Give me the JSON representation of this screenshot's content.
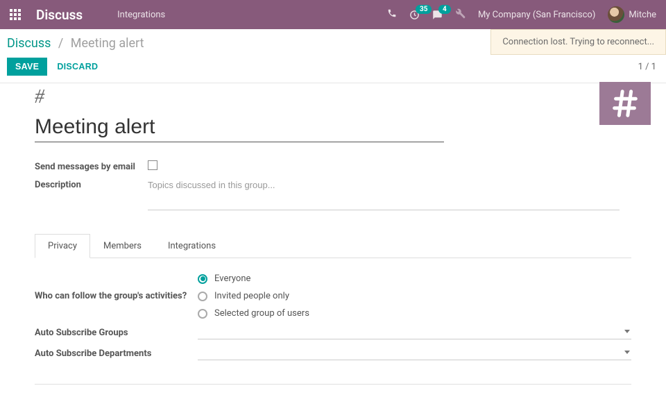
{
  "navbar": {
    "brand": "Discuss",
    "menu": {
      "integrations": "Integrations"
    },
    "badges": {
      "activities": "35",
      "messages": "4"
    },
    "company": "My Company (San Francisco)",
    "user": "Mitche"
  },
  "toast": {
    "message": "Connection lost. Trying to reconnect..."
  },
  "breadcrumb": {
    "root": "Discuss",
    "current": "Meeting alert"
  },
  "actions": {
    "save": "SAVE",
    "discard": "DISCARD"
  },
  "pager": {
    "text": "1 / 1"
  },
  "form": {
    "hash": "#",
    "name": "Meeting alert",
    "send_email_label": "Send messages by email",
    "description_label": "Description",
    "description_placeholder": "Topics discussed in this group..."
  },
  "tabs": {
    "privacy": "Privacy",
    "members": "Members",
    "integrations": "Integrations"
  },
  "privacy": {
    "follow_label": "Who can follow the group's activities?",
    "options": {
      "everyone": "Everyone",
      "invited": "Invited people only",
      "selected": "Selected group of users"
    },
    "auto_groups_label": "Auto Subscribe Groups",
    "auto_departments_label": "Auto Subscribe Departments"
  }
}
